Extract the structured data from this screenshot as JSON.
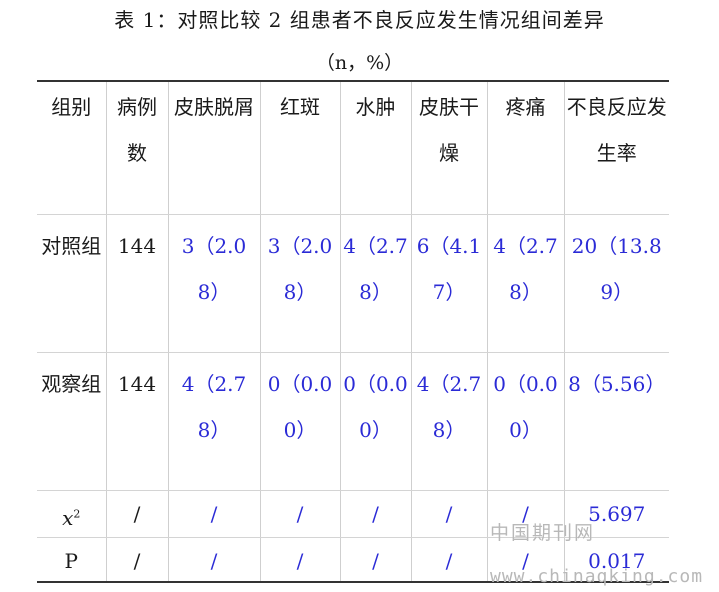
{
  "title": "表 1：对照比较 2 组患者不良反应发生情况组间差异",
  "subtitle": "（n，%）",
  "colors": {
    "value_blue": "#2b2bd6",
    "text": "#1a1a1a",
    "watermark": "#b8b8b8"
  },
  "headers": [
    "组别",
    "病例数",
    "皮肤脱屑",
    "红斑",
    "水肿",
    "皮肤干燥",
    "疼痛",
    "不良反应发生率"
  ],
  "rows": [
    {
      "group": "对照组",
      "cases": "144",
      "values": [
        "3（2.08）",
        "3（2.08）",
        "4（2.78）",
        "6（4.17）",
        "4（2.78）",
        "20（13.89）"
      ]
    },
    {
      "group": "观察组",
      "cases": "144",
      "values": [
        "4（2.78）",
        "0（0.00）",
        "0（0.00）",
        "4（2.78）",
        "0（0.00）",
        "8（5.56）"
      ]
    }
  ],
  "chi_row": {
    "label": "x",
    "sup": "2",
    "cases": "/",
    "values": [
      "/",
      "/",
      "/",
      "/",
      "/",
      "5.697"
    ]
  },
  "p_row": {
    "label": "P",
    "cases": "/",
    "values": [
      "/",
      "/",
      "/",
      "/",
      "/",
      "0.017"
    ]
  },
  "watermark": {
    "line1": "中国期刊网",
    "line2": "www.chinaqking.com"
  }
}
